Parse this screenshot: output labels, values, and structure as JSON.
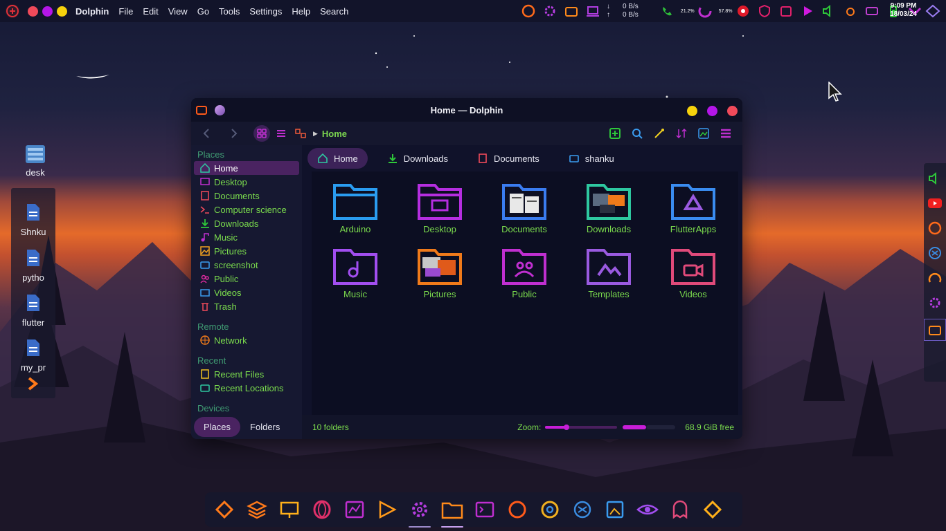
{
  "topbar": {
    "app_name": "Dolphin",
    "menus": [
      "File",
      "Edit",
      "View",
      "Go",
      "Tools",
      "Settings",
      "Help",
      "Search"
    ],
    "net_down": "0 B/s",
    "net_up": "0 B/s",
    "cpu_pct": "21.2%",
    "mem_pct": "57.8%",
    "time": "9:09 PM",
    "date": "18/03/24"
  },
  "desktop": {
    "icons": [
      {
        "label": "desk",
        "icon": "desk-folder-icon"
      },
      {
        "label": "Shnku",
        "icon": "file-icon"
      },
      {
        "label": "pytho",
        "icon": "file-icon"
      },
      {
        "label": "flutter",
        "icon": "file-icon"
      },
      {
        "label": "my_pr",
        "icon": "file-icon"
      }
    ]
  },
  "window": {
    "title": "Home — Dolphin",
    "breadcrumb": "Home",
    "sidebar": {
      "places_title": "Places",
      "places": [
        "Home",
        "Desktop",
        "Documents",
        "Computer science",
        "Downloads",
        "Music",
        "Pictures",
        "screenshot",
        "Public",
        "Videos",
        "Trash"
      ],
      "remote_title": "Remote",
      "remote": [
        "Network"
      ],
      "recent_title": "Recent",
      "recent": [
        "Recent Files",
        "Recent Locations"
      ],
      "devices_title": "Devices"
    },
    "tabs": [
      "Home",
      "Downloads",
      "Documents",
      "shanku"
    ],
    "folders": [
      "Arduino",
      "Desktop",
      "Documents",
      "Downloads",
      "FlutterApps",
      "Music",
      "Pictures",
      "Public",
      "Templates",
      "Videos"
    ],
    "bottom_tabs": [
      "Places",
      "Folders"
    ],
    "status": {
      "count": "10 folders",
      "zoom_label": "Zoom:",
      "zoom_level": 0.3,
      "free": "68.9 GiB free"
    }
  },
  "colors": {
    "accent_green": "#7bdc4d",
    "accent_purple": "#c81ed8",
    "active_bg": "#4a2361"
  }
}
